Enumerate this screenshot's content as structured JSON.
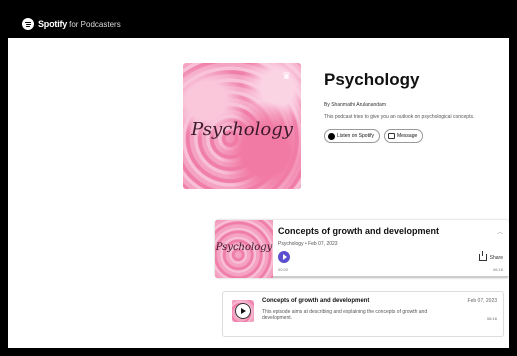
{
  "header": {
    "brand_name": "Spotify",
    "brand_sub": "for Podcasters"
  },
  "show": {
    "cover_text": "Psychology",
    "title": "Psychology",
    "author": "By Shanmathi Arulanandam",
    "description": "This podcast tries to give you an outlook on psychological concepts.",
    "listen_label": "Listen on Spotify",
    "message_label": "Message"
  },
  "player": {
    "cover_text": "Psychology",
    "episode_title": "Concepts of growth and development",
    "meta": "Psychology • Feb 07, 2023",
    "share_label": "Share",
    "time_start": "00:00",
    "time_end": "06:16",
    "progress": 0
  },
  "episodes": [
    {
      "title": "Concepts of growth and development",
      "date": "Feb 07, 2023",
      "description": "This episode aims at describing and explaining the concepts of growth and development.",
      "duration": "06:16"
    }
  ],
  "colors": {
    "accent": "#5b4fcf",
    "topbar": "#000000",
    "cover_pink": "#ef7ea9"
  },
  "icons": [
    "spotify-logo-icon",
    "podcast-mark-icon",
    "spotify-icon",
    "message-icon",
    "play-icon",
    "share-icon",
    "chevron-up-icon"
  ]
}
